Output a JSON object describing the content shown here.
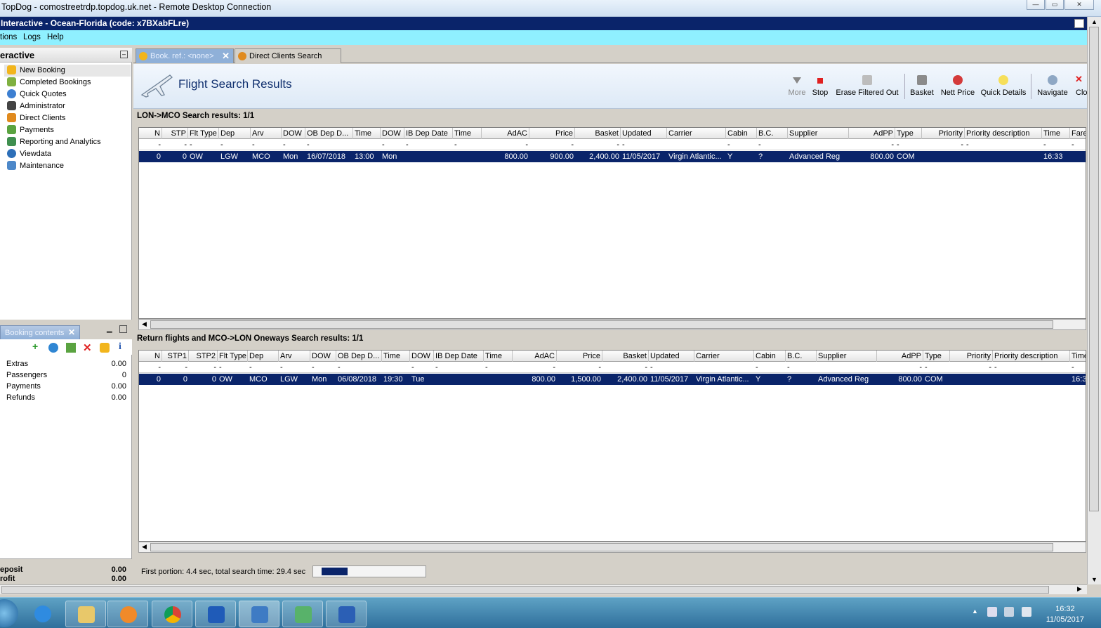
{
  "rdp": {
    "title": "TopDog - comostreetrdp.topdog.uk.net - Remote Desktop Connection"
  },
  "app": {
    "title": "Interactive - Ocean-Florida (code: x7BXabFLre)"
  },
  "menu": [
    "tions",
    "Logs",
    "Help"
  ],
  "left_panel": {
    "title": "eractive",
    "items": [
      "New Booking",
      "Completed Bookings",
      "Quick Quotes",
      "Administrator",
      "Direct Clients",
      "Payments",
      "Reporting and Analytics",
      "Viewdata",
      "Maintenance"
    ]
  },
  "booking_panel": {
    "title": "Booking contents",
    "rows": [
      {
        "label": "Extras",
        "value": "0.00"
      },
      {
        "label": "Passengers",
        "value": "0"
      },
      {
        "label": "Payments",
        "value": "0.00"
      },
      {
        "label": "Refunds",
        "value": "0.00"
      }
    ],
    "totals": [
      {
        "label": "eposit",
        "value": "0.00"
      },
      {
        "label": "rofit",
        "value": "0.00"
      }
    ]
  },
  "tabs": [
    {
      "label": "Book. ref.: <none>"
    },
    {
      "label": "Direct Clients Search"
    }
  ],
  "header": {
    "title": "Flight Search Results"
  },
  "toolbar": [
    "More",
    "Stop",
    "Erase Filtered Out",
    "Basket",
    "Nett Price",
    "Quick Details",
    "Navigate",
    "Clo"
  ],
  "section1": {
    "title": "LON->MCO Search results: 1/1"
  },
  "section2": {
    "title": "Return flights and MCO->LON Oneways Search results: 1/1"
  },
  "grid1": {
    "columns": [
      "N",
      "STP",
      "Flt Type",
      "Dep",
      "Arv",
      "DOW",
      "OB Dep D...",
      "Time",
      "DOW",
      "IB Dep Date",
      "Time",
      "AdAC",
      "Price",
      "Basket",
      "Updated",
      "Carrier",
      "Cabin",
      "B.C.",
      "Supplier",
      "AdPP",
      "Type",
      "Priority",
      "Priority description",
      "Time",
      "Fare"
    ],
    "filters": [
      "-",
      "-",
      "-",
      "-",
      "-",
      "-",
      "-",
      "",
      "-",
      "-",
      "-",
      "-",
      "-",
      "-",
      "-",
      "",
      "-",
      "-",
      "",
      "-",
      "-",
      "-",
      "-",
      "-",
      "-"
    ],
    "row": [
      "0",
      "0",
      "OW",
      "LGW",
      "MCO",
      "Mon",
      "16/07/2018",
      "13:00",
      "Mon",
      "",
      "",
      "800.00",
      "900.00",
      "2,400.00",
      "11/05/2017",
      "Virgin Atlantic...",
      "Y",
      "?",
      "Advanced Reg",
      "800.00",
      "COM",
      "",
      "",
      "16:33",
      ""
    ]
  },
  "grid2": {
    "columns": [
      "N",
      "STP1",
      "STP2",
      "Flt Type",
      "Dep",
      "Arv",
      "DOW",
      "OB Dep D...",
      "Time",
      "DOW",
      "IB Dep Date",
      "Time",
      "AdAC",
      "Price",
      "Basket",
      "Updated",
      "Carrier",
      "Cabin",
      "B.C.",
      "Supplier",
      "AdPP",
      "Type",
      "Priority",
      "Priority description",
      "Time"
    ],
    "filters": [
      "-",
      "-",
      "-",
      "-",
      "-",
      "-",
      "-",
      "-",
      "",
      "-",
      "-",
      "-",
      "-",
      "-",
      "-",
      "-",
      "",
      "-",
      "-",
      "",
      "-",
      "-",
      "-",
      "-",
      "-"
    ],
    "row": [
      "0",
      "0",
      "0",
      "OW",
      "MCO",
      "LGW",
      "Mon",
      "06/08/2018",
      "19:30",
      "Tue",
      "",
      "",
      "800.00",
      "1,500.00",
      "2,400.00",
      "11/05/2017",
      "Virgin Atlantic...",
      "Y",
      "?",
      "Advanced Reg",
      "800.00",
      "COM",
      "",
      "",
      "16:3"
    ]
  },
  "status": {
    "text": "First portion: 4.4 sec, total search time: 29.4 sec",
    "progress": 0.25
  },
  "taskbar": {
    "time": "16:32",
    "date": "11/05/2017"
  }
}
